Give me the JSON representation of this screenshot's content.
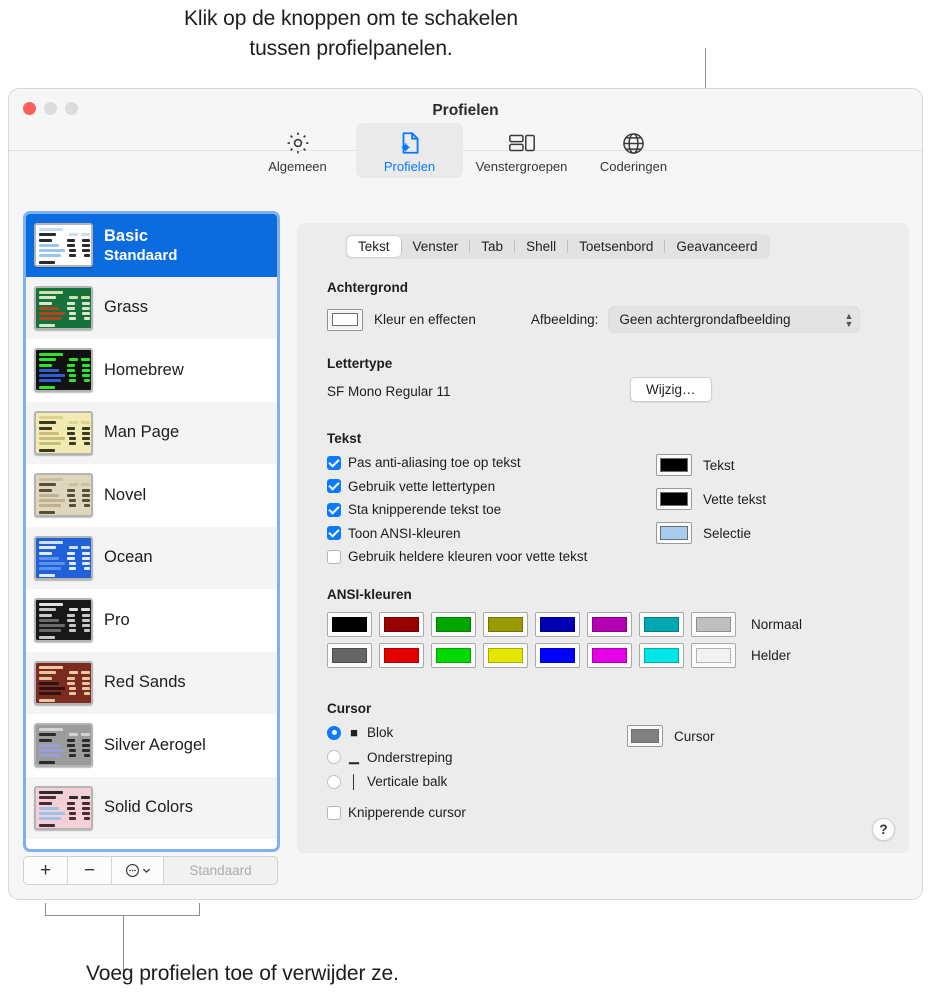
{
  "callouts": {
    "top_line1": "Klik op de knoppen om te schakelen",
    "top_line2": "tussen profielpanelen.",
    "bottom": "Voeg profielen toe of verwijder ze."
  },
  "window": {
    "title": "Profielen",
    "traffic": {
      "close": "close-button",
      "minimize": "minimize-button",
      "zoom": "zoom-button"
    }
  },
  "toolbar": {
    "items": [
      {
        "label": "Algemeen",
        "icon": "gear-icon",
        "active": false
      },
      {
        "label": "Profielen",
        "icon": "document-gear-icon",
        "active": true
      },
      {
        "label": "Venstergroepen",
        "icon": "window-groups-icon",
        "active": false
      },
      {
        "label": "Coderingen",
        "icon": "globe-icon",
        "active": false
      }
    ]
  },
  "sidebar": {
    "profiles": [
      {
        "name": "Basic",
        "subtitle": "Standaard",
        "selected": true,
        "thumb": {
          "bg": "#ffffff",
          "fg": "#2b2b2b",
          "accent": "#9dc4ef",
          "head": "#c8dcf4"
        }
      },
      {
        "name": "Grass",
        "subtitle": "",
        "selected": false,
        "thumb": {
          "bg": "#17713d",
          "fg": "#d9e8c9",
          "accent": "#b5431f",
          "head": "#cfe0a9"
        }
      },
      {
        "name": "Homebrew",
        "subtitle": "",
        "selected": false,
        "thumb": {
          "bg": "#111111",
          "fg": "#2ae52a",
          "accent": "#2f5fd0",
          "head": "#2ae52a"
        }
      },
      {
        "name": "Man Page",
        "subtitle": "",
        "selected": false,
        "thumb": {
          "bg": "#f2eab3",
          "fg": "#3a3a20",
          "accent": "#c9be7a",
          "head": "#ded291"
        }
      },
      {
        "name": "Novel",
        "subtitle": "",
        "selected": false,
        "thumb": {
          "bg": "#ded6bd",
          "fg": "#5a4e38",
          "accent": "#bfb191",
          "head": "#cdbf9e"
        }
      },
      {
        "name": "Ocean",
        "subtitle": "",
        "selected": false,
        "thumb": {
          "bg": "#2060d8",
          "fg": "#e3ecff",
          "accent": "#5b92ef",
          "head": "#cfe0ff"
        }
      },
      {
        "name": "Pro",
        "subtitle": "",
        "selected": false,
        "thumb": {
          "bg": "#181818",
          "fg": "#c8c8c8",
          "accent": "#6a6a6a",
          "head": "#e0e0e0"
        }
      },
      {
        "name": "Red Sands",
        "subtitle": "",
        "selected": false,
        "thumb": {
          "bg": "#7c2b20",
          "fg": "#e8c7a0",
          "accent": "#2e1410",
          "head": "#efcaa2"
        }
      },
      {
        "name": "Silver Aerogel",
        "subtitle": "",
        "selected": false,
        "thumb": {
          "bg": "#9c9c9c",
          "fg": "#2a2a2a",
          "accent": "#9a9ed8",
          "head": "#d3d3d3"
        }
      },
      {
        "name": "Solid Colors",
        "subtitle": "",
        "selected": false,
        "thumb": {
          "bg": "#f3cfd8",
          "fg": "#4a2a32",
          "accent": "#9fc3e8",
          "head": "#2b2b2b"
        }
      }
    ],
    "bottom_bar": {
      "add": "+",
      "remove": "−",
      "more_icon": "more-ellipsis-icon",
      "more_chevron": "⌄",
      "default_button": "Standaard"
    }
  },
  "detail": {
    "tabs": [
      {
        "label": "Tekst",
        "active": true
      },
      {
        "label": "Venster",
        "active": false
      },
      {
        "label": "Tab",
        "active": false
      },
      {
        "label": "Shell",
        "active": false
      },
      {
        "label": "Toetsenbord",
        "active": false
      },
      {
        "label": "Geavanceerd",
        "active": false
      }
    ],
    "background": {
      "heading": "Achtergrond",
      "color_label": "Kleur en effecten",
      "color_value": "#ffffff",
      "image_label": "Afbeelding:",
      "image_value": "Geen achtergrondafbeelding"
    },
    "font": {
      "heading": "Lettertype",
      "value": "SF Mono Regular 11",
      "change_button": "Wijzig…"
    },
    "text": {
      "heading": "Tekst",
      "checkboxes": [
        {
          "label": "Pas anti-aliasing toe op tekst",
          "checked": true
        },
        {
          "label": "Gebruik vette lettertypen",
          "checked": true
        },
        {
          "label": "Sta knipperende tekst toe",
          "checked": true
        },
        {
          "label": "Toon ANSI-kleuren",
          "checked": true
        },
        {
          "label": "Gebruik heldere kleuren voor vette tekst",
          "checked": false
        }
      ],
      "wells": [
        {
          "label": "Tekst",
          "color": "#000000"
        },
        {
          "label": "Vette tekst",
          "color": "#000000"
        },
        {
          "label": "Selectie",
          "color": "#a8cbf0"
        }
      ]
    },
    "ansi": {
      "heading": "ANSI-kleuren",
      "rows": [
        {
          "label": "Normaal",
          "colors": [
            "#000000",
            "#990000",
            "#00a600",
            "#999900",
            "#0000b2",
            "#b200b2",
            "#00a6b2",
            "#bfbfbf"
          ]
        },
        {
          "label": "Helder",
          "colors": [
            "#666666",
            "#e50000",
            "#00d900",
            "#e5e500",
            "#0000ff",
            "#e500e5",
            "#00e5e5",
            "#f2f2f2"
          ]
        }
      ]
    },
    "cursor": {
      "heading": "Cursor",
      "options": [
        {
          "label": "Blok",
          "glyph": "■",
          "selected": true
        },
        {
          "label": "Onderstreping",
          "glyph": "▁",
          "selected": false
        },
        {
          "label": "Verticale balk",
          "glyph": "│",
          "selected": false
        }
      ],
      "blink": {
        "label": "Knipperende cursor",
        "checked": false
      },
      "well": {
        "label": "Cursor",
        "color": "#808080"
      }
    },
    "help_button": "?"
  }
}
